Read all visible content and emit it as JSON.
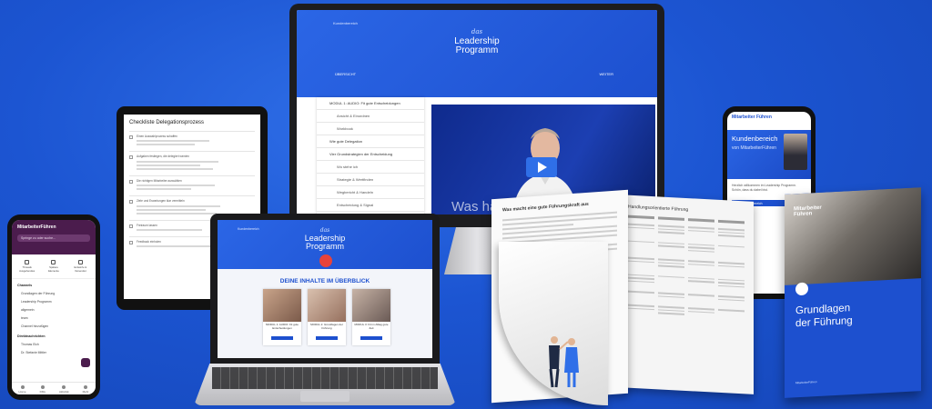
{
  "monitor": {
    "top_label": "Kundenbereich",
    "logo_script": "das",
    "logo_line1": "Leadership",
    "logo_line2": "Programm",
    "nav_left": "ÜBERSICHT",
    "nav_right": "WEITER",
    "sidebar": [
      "MODUL 1: AUDIO: Fit gute Entscheidungen",
      "Ansicht & Einordnen",
      "Workbook",
      "Wie gute Delegation",
      "Vier Grundstrategien der Entscheidung",
      "Wo stehe ich",
      "Strategie & Wertfinden",
      "Wegbericht & Handeln",
      "Entscheidung & Signal"
    ],
    "video_caption": "Was hält dich zurück"
  },
  "tablet": {
    "title": "Checkliste Delegationsprozess",
    "rows": [
      "Einen Auswahlprozess schaffen",
      "Aufgaben festlegen, die delegiert werden",
      "Die richtigen Mitarbeiter auswählen",
      "Ziele und Erwartungen klar vermitteln",
      "Freiraum lassen",
      "Feedback einholen"
    ]
  },
  "laptop": {
    "top_label": "Kundenbereich",
    "logo_script": "das",
    "logo_line1": "Leadership",
    "logo_line2": "Programm",
    "section_title": "DEINE INHALTE IM ÜBERBLICK",
    "cards": [
      {
        "label": "MODUL 1: AUDIO: Fit gute Entscheidungen"
      },
      {
        "label": "MODUL 2: Grundlagen der Führung"
      },
      {
        "label": "MODUL 3: Fit im Alltag gute Zeit"
      }
    ]
  },
  "phone_left": {
    "app_name": "MitarbeiterFühren",
    "search_placeholder": "Springe zu oder suche...",
    "actions": [
      "Threads Ausgehendes",
      "Spätere Elemente",
      "Entwürfe & Versendet"
    ],
    "section_channels": "Channels",
    "channels": [
      "Grundlagen der Führung",
      "Leadership Programm",
      "allgemein",
      "team",
      "Channel hinzufügen"
    ],
    "section_dm": "Direktnachrichten",
    "dms": [
      "Thomas Eich",
      "Dr. Stefanie Mittler"
    ],
    "tabs": [
      "Home",
      "DMs",
      "Aktivität",
      "Mehr"
    ]
  },
  "phone_right": {
    "brand": "Mitarbeiter Führen",
    "hero_title": "Kundenbereich",
    "hero_sub": "von MitarbeiterFühren",
    "body": "Herzlich willkommen im Leadership Programm. Schön, dass du dabei bist.",
    "button": "Zum Kundenbereich"
  },
  "document": {
    "left_heading": "Was macht eine gute Führungskraft aus",
    "right_heading": "Handlungsorientierte Führung"
  },
  "cover": {
    "brand_line1": "Mitarbeiter",
    "brand_line2": "Führen",
    "title_line1": "Grundlagen",
    "title_line2": "der Führung",
    "footer": "MitarbeiterFühren"
  },
  "colors": {
    "background": "#1c55d2",
    "brand_blue": "#1d50cf",
    "accent_red": "#e7433c",
    "slack_purple": "#4b1c4d"
  }
}
